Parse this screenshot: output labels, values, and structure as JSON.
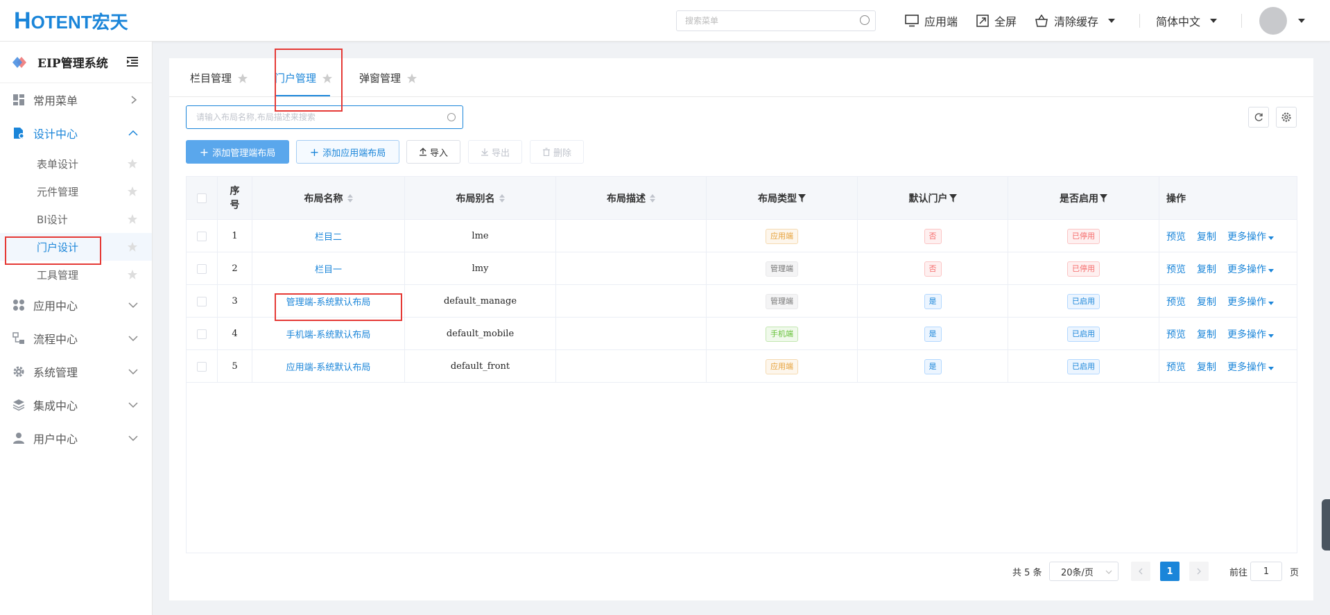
{
  "header": {
    "logo_h": "H",
    "logo_rest": "OTENT宏天",
    "search_placeholder": "搜索菜单",
    "app_end": "应用端",
    "fullscreen": "全屏",
    "clear_cache": "清除缓存",
    "language": "简体中文"
  },
  "sidebar": {
    "title": "EIP管理系统",
    "items": [
      {
        "label": "常用菜单"
      },
      {
        "label": "设计中心"
      },
      {
        "label": "应用中心"
      },
      {
        "label": "流程中心"
      },
      {
        "label": "系统管理"
      },
      {
        "label": "集成中心"
      },
      {
        "label": "用户中心"
      }
    ],
    "subitems": [
      {
        "label": "表单设计"
      },
      {
        "label": "元件管理"
      },
      {
        "label": "BI设计"
      },
      {
        "label": "门户设计"
      },
      {
        "label": "工具管理"
      }
    ]
  },
  "tabs": [
    {
      "label": "栏目管理"
    },
    {
      "label": "门户管理"
    },
    {
      "label": "弹窗管理"
    }
  ],
  "filter": {
    "placeholder": "请输入布局名称,布局描述来搜索"
  },
  "toolbar": {
    "add_manage": "添加管理端布局",
    "add_app": "添加应用端布局",
    "import": "导入",
    "export": "导出",
    "delete": "删除"
  },
  "table": {
    "columns": {
      "seq": "序号",
      "name": "布局名称",
      "alias": "布局别名",
      "desc": "布局描述",
      "type": "布局类型",
      "default": "默认门户",
      "enabled": "是否启用",
      "ops": "操作"
    },
    "rows": [
      {
        "seq": "1",
        "name": "栏目二",
        "alias": "lme",
        "desc": "",
        "type": "应用端",
        "default": "否",
        "enabled": "已停用"
      },
      {
        "seq": "2",
        "name": "栏目一",
        "alias": "lmy",
        "desc": "",
        "type": "管理端",
        "default": "否",
        "enabled": "已停用"
      },
      {
        "seq": "3",
        "name": "管理端-系统默认布局",
        "alias": "default_manage",
        "desc": "",
        "type": "管理端",
        "default": "是",
        "enabled": "已启用"
      },
      {
        "seq": "4",
        "name": "手机端-系统默认布局",
        "alias": "default_mobile",
        "desc": "",
        "type": "手机端",
        "default": "是",
        "enabled": "已启用"
      },
      {
        "seq": "5",
        "name": "应用端-系统默认布局",
        "alias": "default_front",
        "desc": "",
        "type": "应用端",
        "default": "是",
        "enabled": "已启用"
      }
    ],
    "ops": {
      "preview": "预览",
      "copy": "复制",
      "more": "更多操作"
    }
  },
  "pagination": {
    "total": "共 5 条",
    "page_size": "20条/页",
    "current_page": "1",
    "goto_prefix": "前往",
    "goto_value": "1",
    "goto_suffix": "页"
  },
  "colors": {
    "accent": "#1a85d9",
    "highlight_box": "#e53935"
  }
}
